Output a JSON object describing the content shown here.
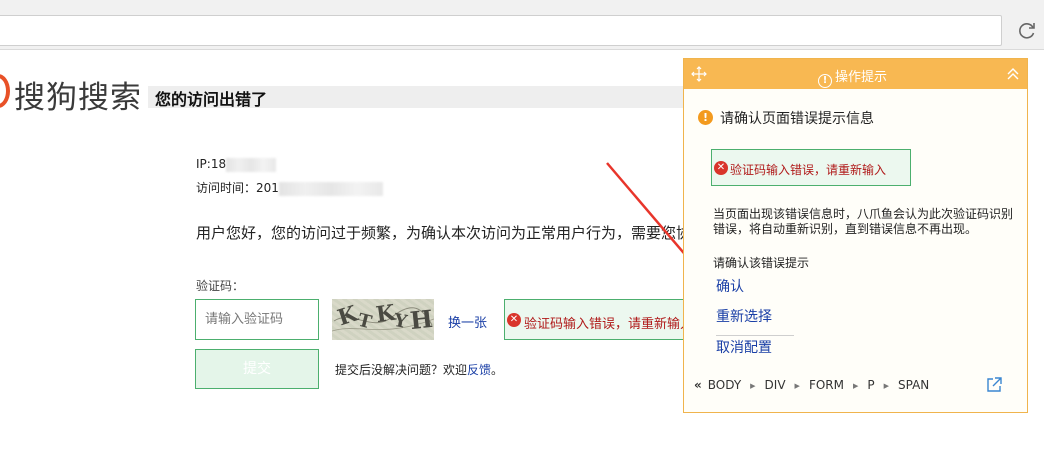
{
  "sogou": {
    "logo_text": "搜狗搜索",
    "page_title": "您的访问出错了",
    "ip_label": "IP:18",
    "time_label": "访问时间：201",
    "greeting": "用户您好，您的访问过于频繁，为确认本次访问为正常用户行为，需要您协助验证。",
    "captcha_label": "验证码：",
    "captcha_placeholder": "请输入验证码",
    "captcha_chars": [
      "K",
      "T",
      "K",
      "Y",
      "H"
    ],
    "swap_link": "换一张",
    "error_message": "验证码输入错误，请重新输入",
    "submit_label": "提交",
    "feedback_prefix": "提交后没解决问题？欢迎",
    "feedback_link": "反馈",
    "feedback_suffix": "。"
  },
  "panel": {
    "title": "操作提示",
    "warning": "请确认页面错误提示信息",
    "preview_error": "验证码输入错误，请重新输入",
    "description": "当页面出现该错误信息时，八爪鱼会认为此次验证码识别错误，将自动重新识别，直到错误信息不再出现。",
    "confirm_question": "请确认该错误提示",
    "options": [
      "确认",
      "重新选择",
      "取消配置"
    ],
    "breadcrumb": [
      "BODY",
      "DIV",
      "FORM",
      "P",
      "SPAN"
    ]
  },
  "colors": {
    "accent_orange": "#f8b852",
    "link_blue": "#1a3fa6",
    "error_red": "#b01a1a",
    "success_green": "#4caf6e",
    "arrow_red": "#e8352b"
  },
  "icons": {
    "reload": "reload-icon",
    "move": "move-icon",
    "info": "info-icon",
    "collapse": "double-chevron-up-icon",
    "warning": "warning-icon",
    "error": "error-x-icon",
    "external": "external-link-icon"
  }
}
